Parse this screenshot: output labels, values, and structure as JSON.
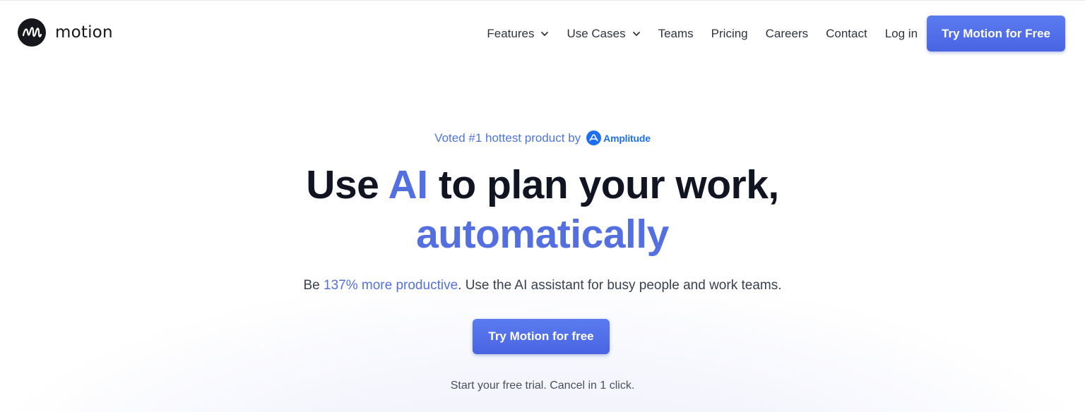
{
  "brand": {
    "name": "motion",
    "logo_icon": "motion-logo-icon"
  },
  "nav": {
    "items": [
      {
        "label": "Features",
        "dropdown": true
      },
      {
        "label": "Use Cases",
        "dropdown": true
      },
      {
        "label": "Teams",
        "dropdown": false
      },
      {
        "label": "Pricing",
        "dropdown": false
      },
      {
        "label": "Careers",
        "dropdown": false
      },
      {
        "label": "Contact",
        "dropdown": false
      },
      {
        "label": "Log in",
        "dropdown": false
      }
    ],
    "cta_label": "Try Motion for Free"
  },
  "hero": {
    "voted_text": "Voted #1 hottest product by",
    "voted_brand": "Amplitude",
    "headline_before": "Use ",
    "headline_accent": "AI",
    "headline_after": " to plan your work,",
    "headline_line2": "automatically",
    "sub_before": "Be ",
    "sub_highlight": "137% more productive",
    "sub_after": ". Use the AI assistant for busy people and work teams.",
    "cta_label": "Try Motion for free",
    "trial_note": "Start your free trial. Cancel in 1 click."
  },
  "colors": {
    "accent": "#5470e0",
    "button": "#4f6be6",
    "amplitude_blue": "#1e6ff0",
    "text_dark": "#111522"
  }
}
